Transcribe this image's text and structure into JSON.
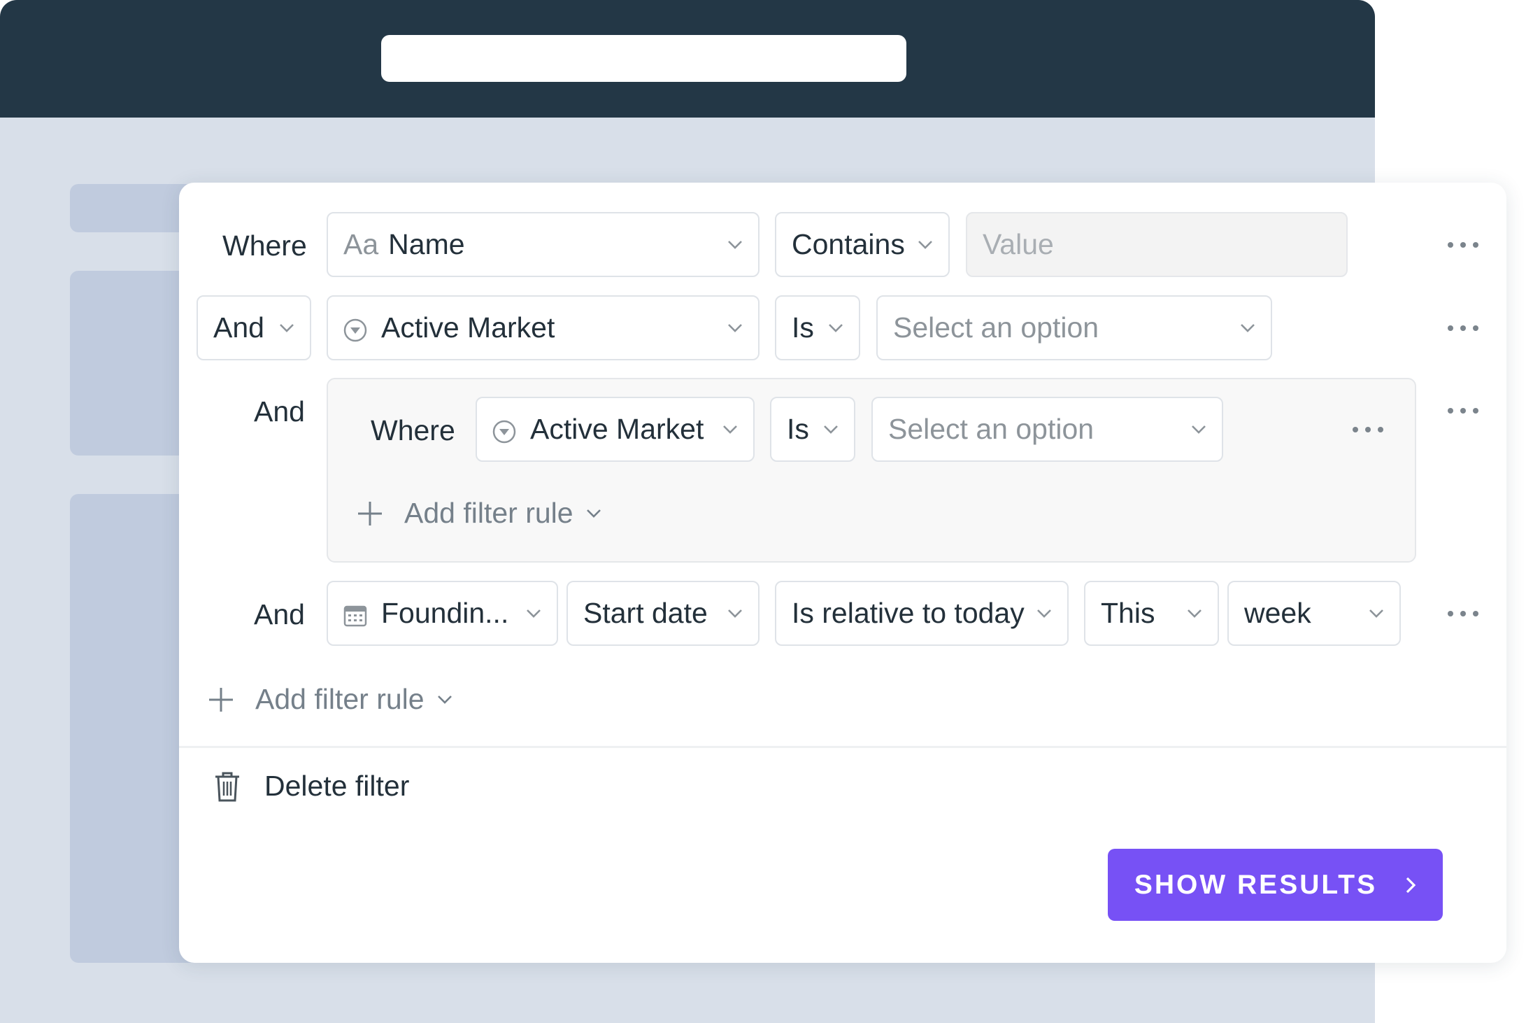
{
  "filter": {
    "rows": [
      {
        "connector": "Where",
        "field": {
          "icon": "text-type-icon",
          "icon_text": "Aa",
          "label": "Name"
        },
        "operator": "Contains",
        "value_placeholder": "Value"
      },
      {
        "connector": "And",
        "field": {
          "icon": "select-property-icon",
          "label": "Active Market"
        },
        "operator": "Is",
        "value_placeholder": "Select an option"
      },
      {
        "connector": "And",
        "group": {
          "rows": [
            {
              "connector": "Where",
              "field": {
                "icon": "select-property-icon",
                "label": "Active Market"
              },
              "operator": "Is",
              "value_placeholder": "Select an option"
            }
          ],
          "add_rule_label": "Add filter rule"
        }
      },
      {
        "connector": "And",
        "field": {
          "icon": "calendar-icon",
          "label": "Foundin..."
        },
        "date_part": "Start date",
        "operator": "Is relative to today",
        "relative": "This",
        "unit": "week"
      }
    ],
    "add_rule_label": "Add filter rule",
    "delete_label": "Delete filter",
    "show_results_label": "SHOW RESULTS"
  },
  "colors": {
    "topbar": "#233746",
    "accent": "#7751f5",
    "background": "#d8dfe9"
  }
}
